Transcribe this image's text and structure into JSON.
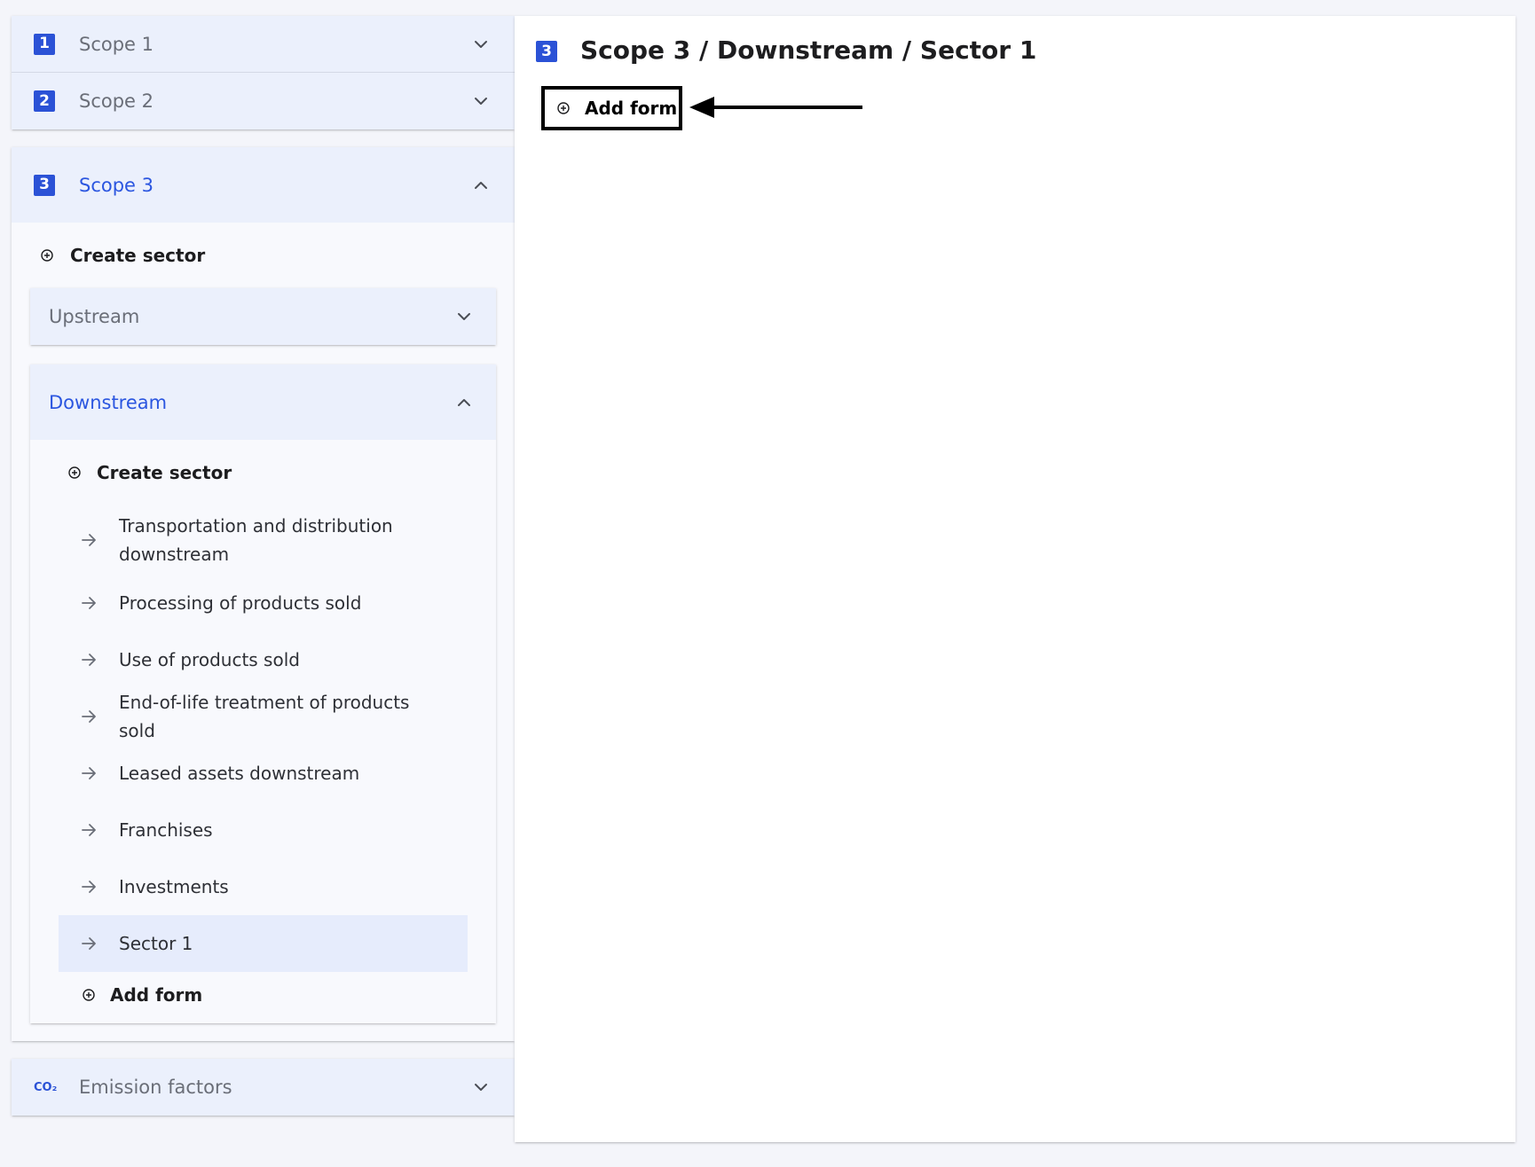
{
  "sidebar": {
    "scope1": {
      "number": "1",
      "label": "Scope 1"
    },
    "scope2": {
      "number": "2",
      "label": "Scope 2"
    },
    "scope3": {
      "number": "3",
      "label": "Scope 3",
      "create_sector": "Create sector",
      "upstream": {
        "label": "Upstream"
      },
      "downstream": {
        "label": "Downstream",
        "create_sector": "Create sector",
        "items": [
          {
            "label": "Transportation and distribution downstream"
          },
          {
            "label": "Processing of products sold"
          },
          {
            "label": "Use of products sold"
          },
          {
            "label": "End-of-life treatment of products sold"
          },
          {
            "label": "Leased assets downstream"
          },
          {
            "label": "Franchises"
          },
          {
            "label": "Investments"
          },
          {
            "label": "Sector 1"
          }
        ],
        "add_form": "Add form"
      }
    },
    "emission_factors": {
      "icon_text": "CO₂",
      "label": "Emission factors"
    }
  },
  "main": {
    "scope_number": "3",
    "title": "Scope 3 / Downstream / Sector 1",
    "add_form_button": "Add form"
  },
  "colors": {
    "accent": "#2b52d6",
    "header_bg": "#ebf0fc",
    "selected_bg": "#e6ecfc",
    "page_bg": "#f4f5fa"
  }
}
